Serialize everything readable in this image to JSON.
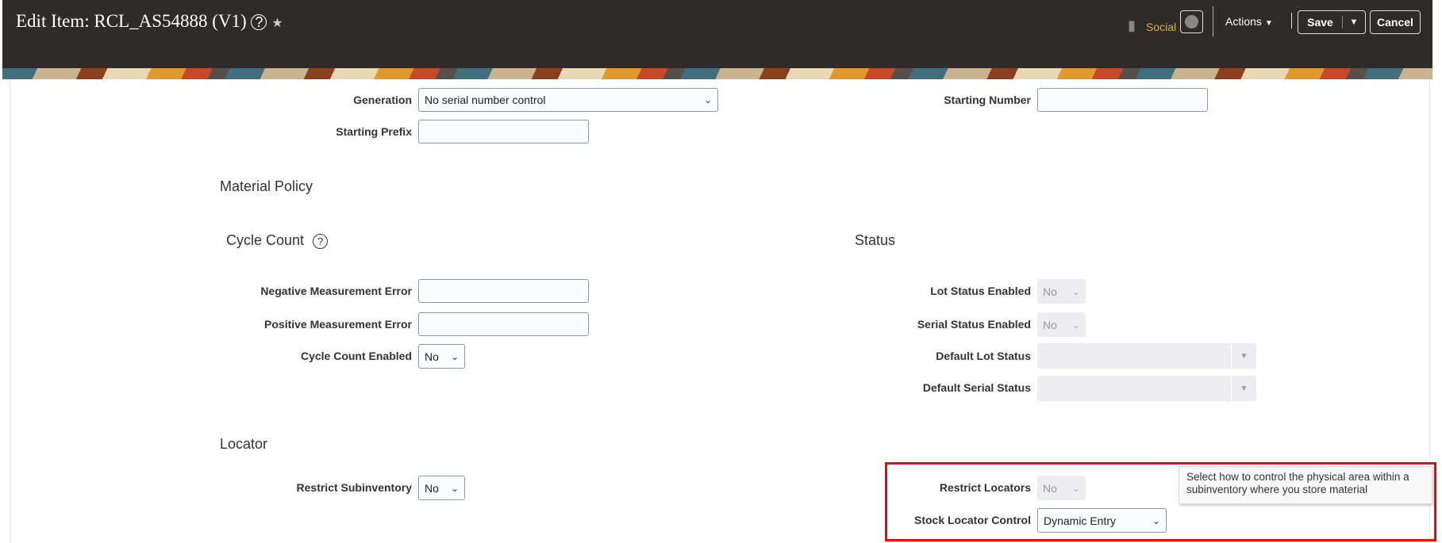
{
  "header": {
    "title": "Edit Item: RCL_AS54888 (V1)",
    "social": "Social",
    "actions": "Actions",
    "save": "Save",
    "cancel": "Cancel"
  },
  "form": {
    "generation": {
      "label": "Generation",
      "value": "No serial number control"
    },
    "starting_prefix": {
      "label": "Starting Prefix",
      "value": ""
    },
    "starting_number": {
      "label": "Starting Number",
      "value": ""
    },
    "material_policy": "Material Policy",
    "cycle_count": {
      "heading": "Cycle Count",
      "negative_label": "Negative Measurement Error",
      "positive_label": "Positive Measurement Error",
      "enabled_label": "Cycle Count Enabled",
      "enabled_value": "No"
    },
    "status": {
      "heading": "Status",
      "lot_enabled_label": "Lot Status Enabled",
      "lot_enabled_value": "No",
      "serial_enabled_label": "Serial Status Enabled",
      "serial_enabled_value": "No",
      "default_lot_label": "Default Lot Status",
      "default_serial_label": "Default Serial Status"
    },
    "locator": {
      "heading": "Locator",
      "restrict_sub_label": "Restrict Subinventory",
      "restrict_sub_value": "No",
      "restrict_loc_label": "Restrict Locators",
      "restrict_loc_value": "No",
      "stock_label": "Stock Locator Control",
      "stock_value": "Dynamic Entry"
    },
    "tooltip": "Select how to control the physical area within a subinventory where you store material"
  },
  "colors": {
    "highlight": "#ff0000",
    "header_bg": "#2f2b28",
    "social": "#d6b04a"
  }
}
